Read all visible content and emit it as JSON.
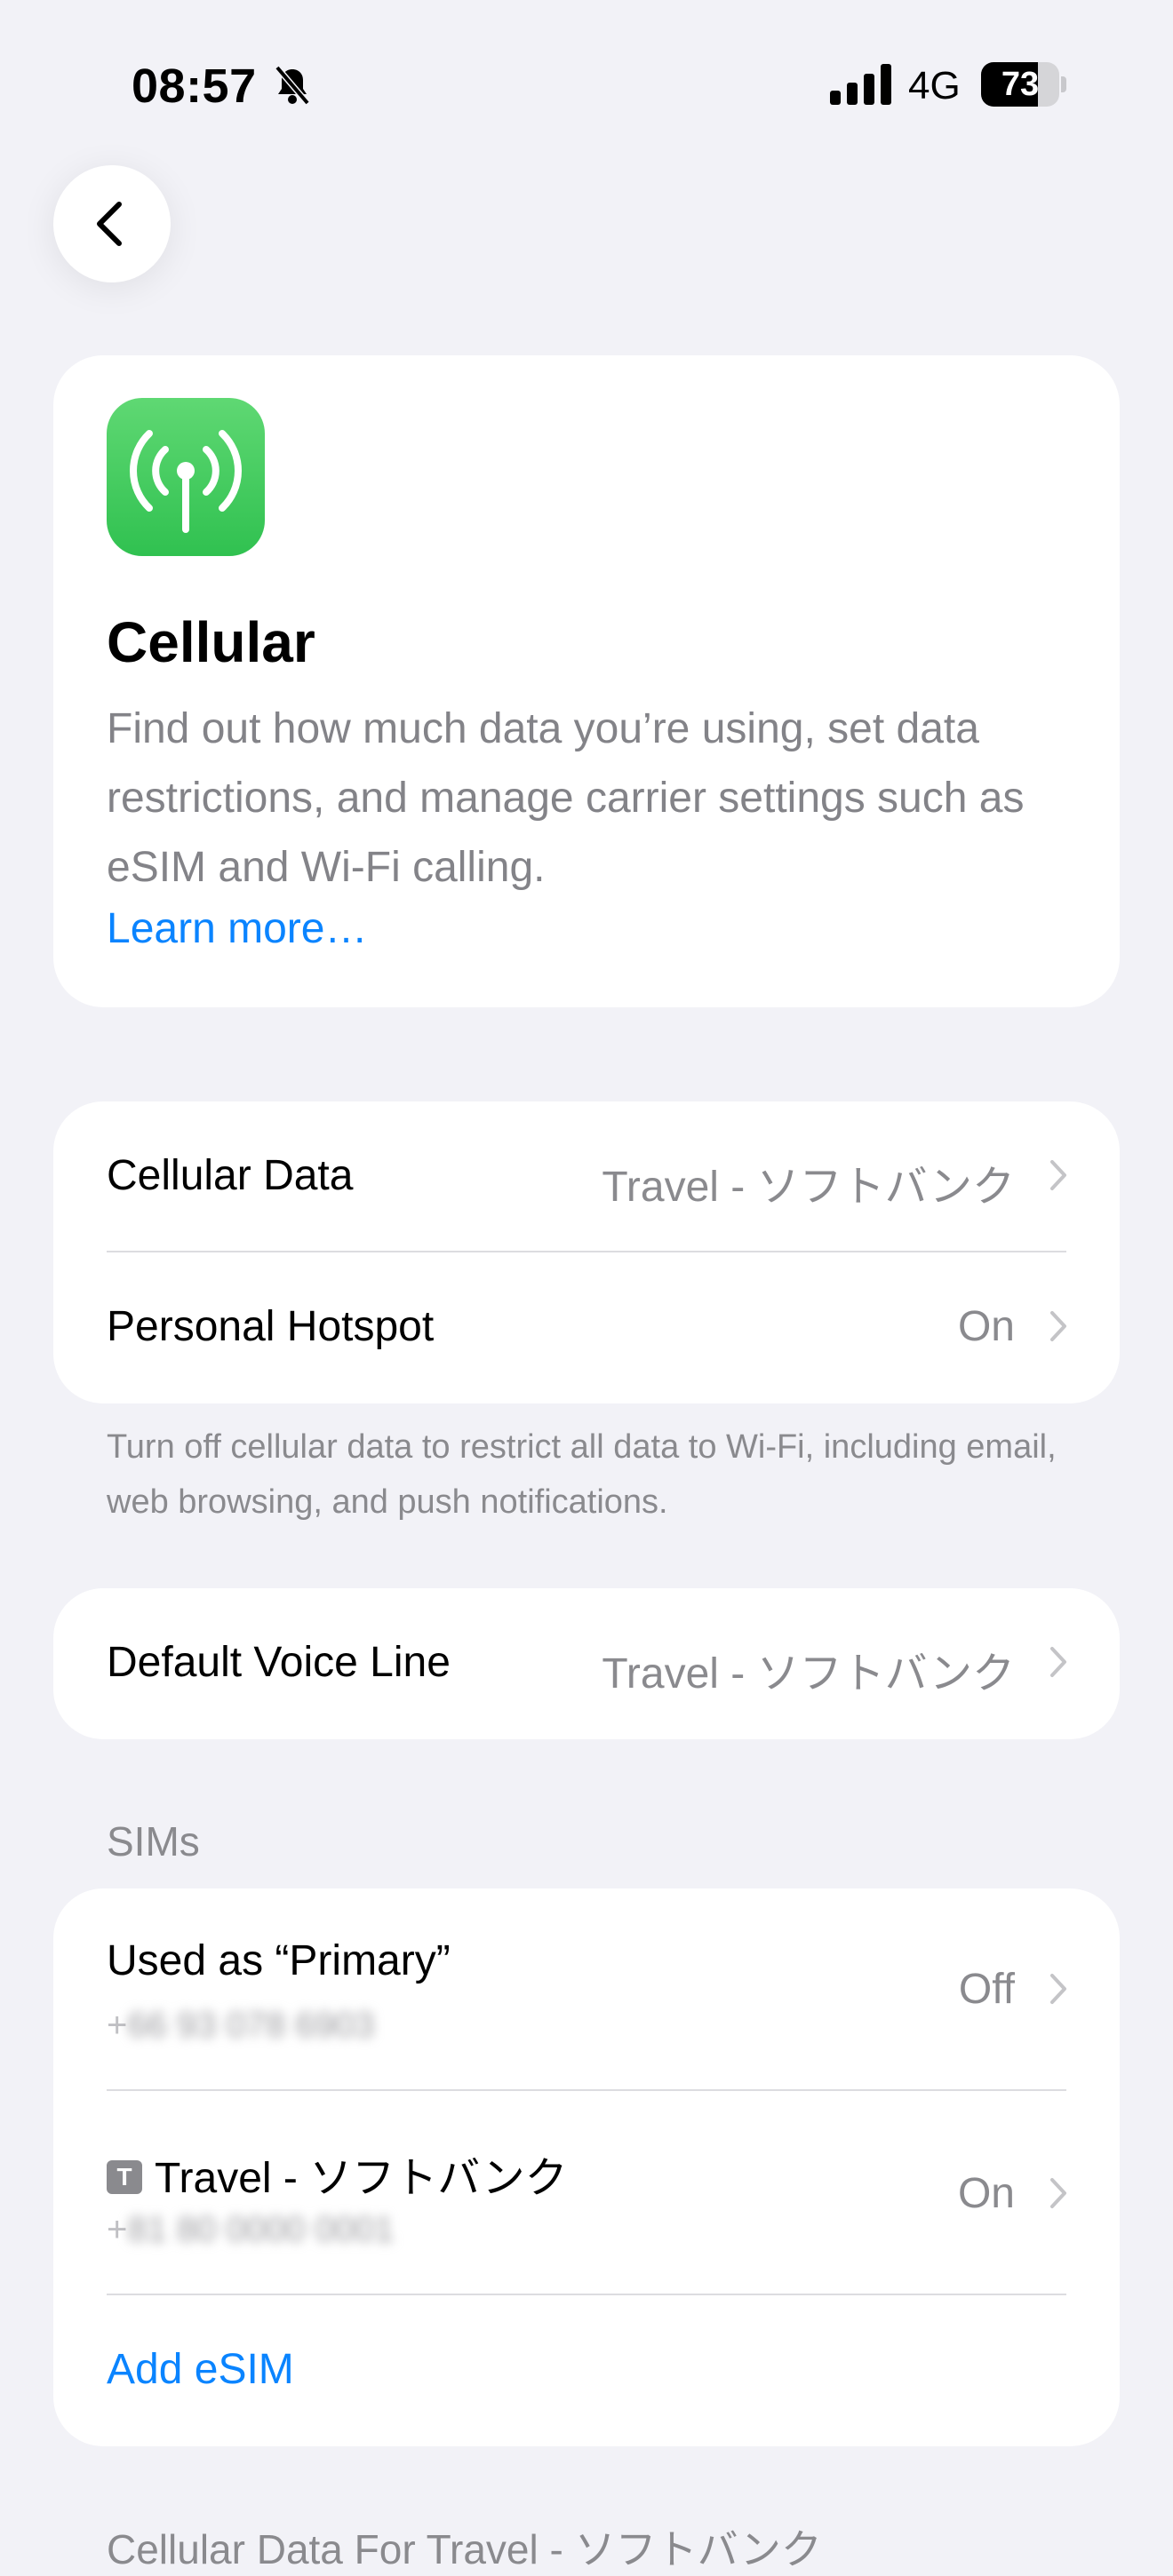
{
  "status_bar": {
    "time": "08:57",
    "network": "4G",
    "battery_level": "73",
    "battery_fraction": 0.73,
    "silent_icon": "bell-slash-icon",
    "signal_icon": "cellular-signal-icon"
  },
  "nav": {
    "back_icon": "chevron-left-icon"
  },
  "hero": {
    "icon": "antenna-icon",
    "icon_color": "#34c759",
    "title": "Cellular",
    "description": "Find out how much data you’re using, set data restrictions, and manage carrier settings such as eSIM and Wi-Fi calling.",
    "link": "Learn more…"
  },
  "data_group": {
    "rows": [
      {
        "label": "Cellular Data",
        "value": "Travel - ソフトバンク"
      },
      {
        "label": "Personal Hotspot",
        "value": "On"
      }
    ],
    "footer": "Turn off cellular data to restrict all data to Wi-Fi, including email, web browsing, and push notifications."
  },
  "voice_group": {
    "rows": [
      {
        "label": "Default Voice Line",
        "value": "Travel - ソフトバンク"
      }
    ]
  },
  "sims": {
    "header": "SIMs",
    "rows": [
      {
        "label": "Used as “Primary”",
        "number_prefix": "+",
        "number_blurred": "66 93 078 6903",
        "value": "Off"
      },
      {
        "tag": "T",
        "label": "Travel - ソフトバンク",
        "number_prefix": "+",
        "number_blurred": "81 80 0000 0001",
        "value": "On"
      }
    ],
    "add_label": "Add eSIM"
  },
  "next_section_header": "Cellular Data For Travel - ソフトバンク",
  "colors": {
    "accent": "#0a84ff",
    "background": "#f2f2f7",
    "secondary_text": "#8a8a8e"
  }
}
